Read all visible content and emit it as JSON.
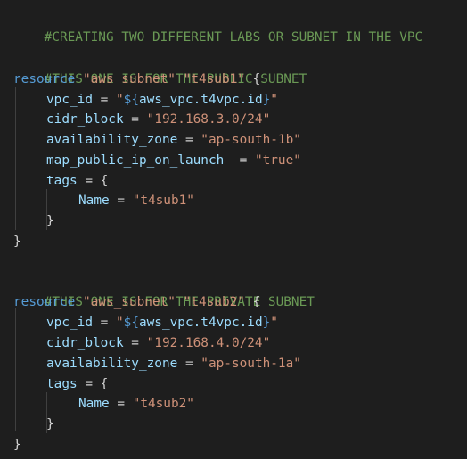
{
  "editor": {
    "lines": {
      "l1": {
        "comment": "#CREATING TWO DIFFERENT LABS OR SUBNET IN THE VPC"
      },
      "l3": {
        "comment": "#THIS ONE IS FOR THE PUBLIC SUBNET"
      },
      "l4": {
        "keyword": "resource",
        "type": "\"aws_subnet\"",
        "name": "\"t4sub1\"",
        "brace": " {"
      },
      "l5": {
        "attr": "vpc_id",
        "eq": " = ",
        "q1": "\"",
        "interp_open": "${",
        "ref": "aws_vpc.t4vpc.id",
        "interp_close": "}",
        "q2": "\""
      },
      "l6": {
        "attr": "cidr_block",
        "eq": " = ",
        "value": "\"192.168.3.0/24\""
      },
      "l7": {
        "attr": "availability_zone",
        "eq": " = ",
        "value": "\"ap-south-1b\""
      },
      "l8": {
        "attr": "map_public_ip_on_launch",
        "eq": "  = ",
        "value": "\"true\""
      },
      "l9": {
        "attr": "tags",
        "eq": " = ",
        "brace": "{"
      },
      "l10": {
        "attr": "Name",
        "eq": " = ",
        "value": "\"t4sub1\""
      },
      "l11": {
        "brace": "}"
      },
      "l12": {
        "brace": "}"
      },
      "l14": {
        "comment": "#THIS ONE IS FOR THE PRIVATE SUBNET"
      },
      "l15": {
        "keyword": "resource",
        "type": "\"aws_subnet\"",
        "name": "\"t4sub2\"",
        "brace": " {"
      },
      "l16": {
        "attr": "vpc_id",
        "eq": " = ",
        "q1": "\"",
        "interp_open": "${",
        "ref": "aws_vpc.t4vpc.id",
        "interp_close": "}",
        "q2": "\""
      },
      "l17": {
        "attr": "cidr_block",
        "eq": " = ",
        "value": "\"192.168.4.0/24\""
      },
      "l18": {
        "attr": "availability_zone",
        "eq": " = ",
        "value": "\"ap-south-1a\""
      },
      "l19": {
        "attr": "tags",
        "eq": " = ",
        "brace": "{"
      },
      "l20": {
        "attr": "Name",
        "eq": " = ",
        "value": "\"t4sub2\""
      },
      "l21": {
        "brace": "}"
      },
      "l22": {
        "brace": "}"
      }
    }
  }
}
